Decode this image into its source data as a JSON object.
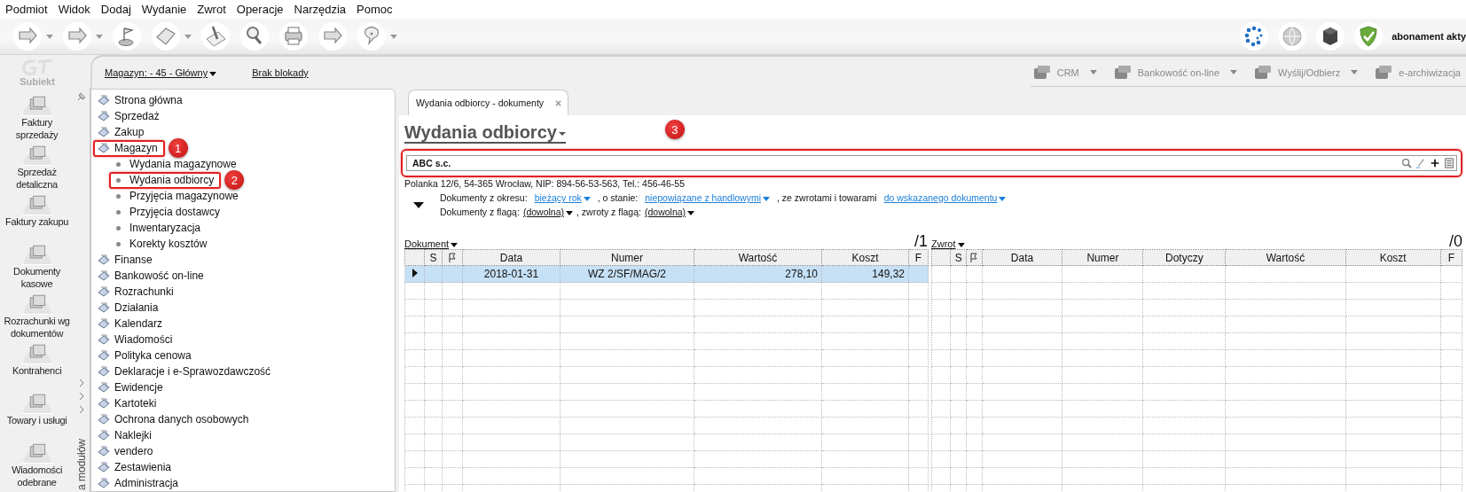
{
  "menu": [
    "Podmiot",
    "Widok",
    "Dodaj",
    "Wydanie",
    "Zwrot",
    "Operacje",
    "Narzędzia",
    "Pomoc"
  ],
  "toolbar": [
    {
      "dropdown": true
    },
    {
      "dropdown": true
    },
    {
      "dropdown": false
    },
    {
      "dropdown": true
    },
    {
      "dropdown": false
    },
    {
      "dropdown": false
    },
    {
      "dropdown": false
    },
    {
      "dropdown": false
    },
    {
      "dropdown": true
    }
  ],
  "status": {
    "label": "abonament akty"
  },
  "brand": "Subiekt",
  "modules": [
    {
      "label": "Faktury sprzedaży"
    },
    {
      "label": "Sprzedaż detaliczna"
    },
    {
      "label": "Faktury zakupu"
    },
    {
      "label": "Dokumenty kasowe"
    },
    {
      "label": "Rozrachunki wg dokumentów"
    },
    {
      "label": "Kontrahenci"
    },
    {
      "label": "Towary i usługi"
    },
    {
      "label": "Wiadomości odebrane"
    }
  ],
  "strip_label": "a modułów",
  "warehouse": {
    "label": "Magazyn: - 45 - Główny"
  },
  "lock": "Brak blokady",
  "top_actions": [
    {
      "label": "CRM",
      "disabled": true,
      "dropdown": true
    },
    {
      "label": "Bankowość on-line",
      "disabled": true,
      "dropdown": true
    },
    {
      "label": "Wyślij/Odbierz",
      "disabled": true,
      "dropdown": true
    },
    {
      "label": "e-archiwizacja",
      "disabled": true,
      "dropdown": false
    }
  ],
  "tree": [
    {
      "label": "Strona główna",
      "highlighted": false
    },
    {
      "label": "Sprzedaż",
      "highlighted": false
    },
    {
      "label": "Zakup",
      "highlighted": false
    },
    {
      "label": "Magazyn",
      "highlighted": true,
      "callout": "1",
      "children": [
        {
          "label": "Wydania magazynowe",
          "highlighted": false
        },
        {
          "label": "Wydania odbiorcy",
          "highlighted": true,
          "callout": "2"
        },
        {
          "label": "Przyjęcia magazynowe",
          "highlighted": false
        },
        {
          "label": "Przyjęcia dostawcy",
          "highlighted": false
        },
        {
          "label": "Inwentaryzacja",
          "highlighted": false
        },
        {
          "label": "Korekty kosztów",
          "highlighted": false
        }
      ]
    },
    {
      "label": "Finanse",
      "highlighted": false
    },
    {
      "label": "Bankowość on-line",
      "highlighted": false
    },
    {
      "label": "Rozrachunki",
      "highlighted": false
    },
    {
      "label": "Działania",
      "highlighted": false
    },
    {
      "label": "Kalendarz",
      "highlighted": false
    },
    {
      "label": "Wiadomości",
      "highlighted": false
    },
    {
      "label": "Polityka cenowa",
      "highlighted": false
    },
    {
      "label": "Deklaracje i e-Sprawozdawczość",
      "highlighted": false
    },
    {
      "label": "Ewidencje",
      "highlighted": false
    },
    {
      "label": "Kartoteki",
      "highlighted": false
    },
    {
      "label": "Ochrona danych osobowych",
      "highlighted": false
    },
    {
      "label": "Naklejki",
      "highlighted": false
    },
    {
      "label": "vendero",
      "highlighted": false
    },
    {
      "label": "Zestawienia",
      "highlighted": false
    },
    {
      "label": "Administracja",
      "highlighted": false
    }
  ],
  "tab": {
    "label": "Wydania odbiorcy - dokumenty",
    "selected": true
  },
  "title": "Wydania odbiorcy",
  "title_callout": "3",
  "customer": {
    "value": "ABC s.c.",
    "highlighted": true
  },
  "address": "Polanka  12/6, 54-365 Wrocław, NIP: 894-56-53-563, Tel.: 456-46-55",
  "filter_rows": [
    [
      {
        "kind": "text",
        "text": "Dokumenty z okresu:"
      },
      {
        "kind": "link",
        "text": "bieżący rok"
      },
      {
        "kind": "text",
        "text": ", o stanie:"
      },
      {
        "kind": "link",
        "text": "niepowiązane z handlowymi"
      },
      {
        "kind": "text",
        "text": ", ze zwrotami i towarami"
      },
      {
        "kind": "link",
        "text": "do wskazanego dokumentu"
      }
    ],
    [
      {
        "kind": "text",
        "text": "Dokumenty z flagą:"
      },
      {
        "kind": "choice",
        "text": "(dowolna)"
      },
      {
        "kind": "text",
        "text": ", zwroty z flagą:"
      },
      {
        "kind": "choice",
        "text": "(dowolna)"
      }
    ]
  ],
  "documents": {
    "label": "Dokument",
    "count": "/1",
    "columns": [
      {
        "kind": "marker"
      },
      {
        "kind": "text",
        "label": "S"
      },
      {
        "kind": "flag"
      },
      {
        "kind": "text",
        "label": "Data"
      },
      {
        "kind": "text",
        "label": "Numer"
      },
      {
        "kind": "text",
        "label": "Wartość"
      },
      {
        "kind": "text",
        "label": "Koszt"
      },
      {
        "kind": "text",
        "label": "F"
      }
    ],
    "rows": [
      {
        "selected": true,
        "cells": [
          "",
          "",
          "",
          "2018-01-31",
          "WZ 2/SF/MAG/2",
          "278,10",
          "149,32",
          ""
        ]
      }
    ]
  },
  "returns": {
    "label": "Zwrot",
    "count": "/0",
    "columns": [
      {
        "kind": "marker"
      },
      {
        "kind": "text",
        "label": "S"
      },
      {
        "kind": "flag"
      },
      {
        "kind": "text",
        "label": "Data"
      },
      {
        "kind": "text",
        "label": "Numer"
      },
      {
        "kind": "text",
        "label": "Dotyczy"
      },
      {
        "kind": "text",
        "label": "Wartość"
      },
      {
        "kind": "text",
        "label": "Koszt"
      },
      {
        "kind": "text",
        "label": "F"
      }
    ]
  }
}
